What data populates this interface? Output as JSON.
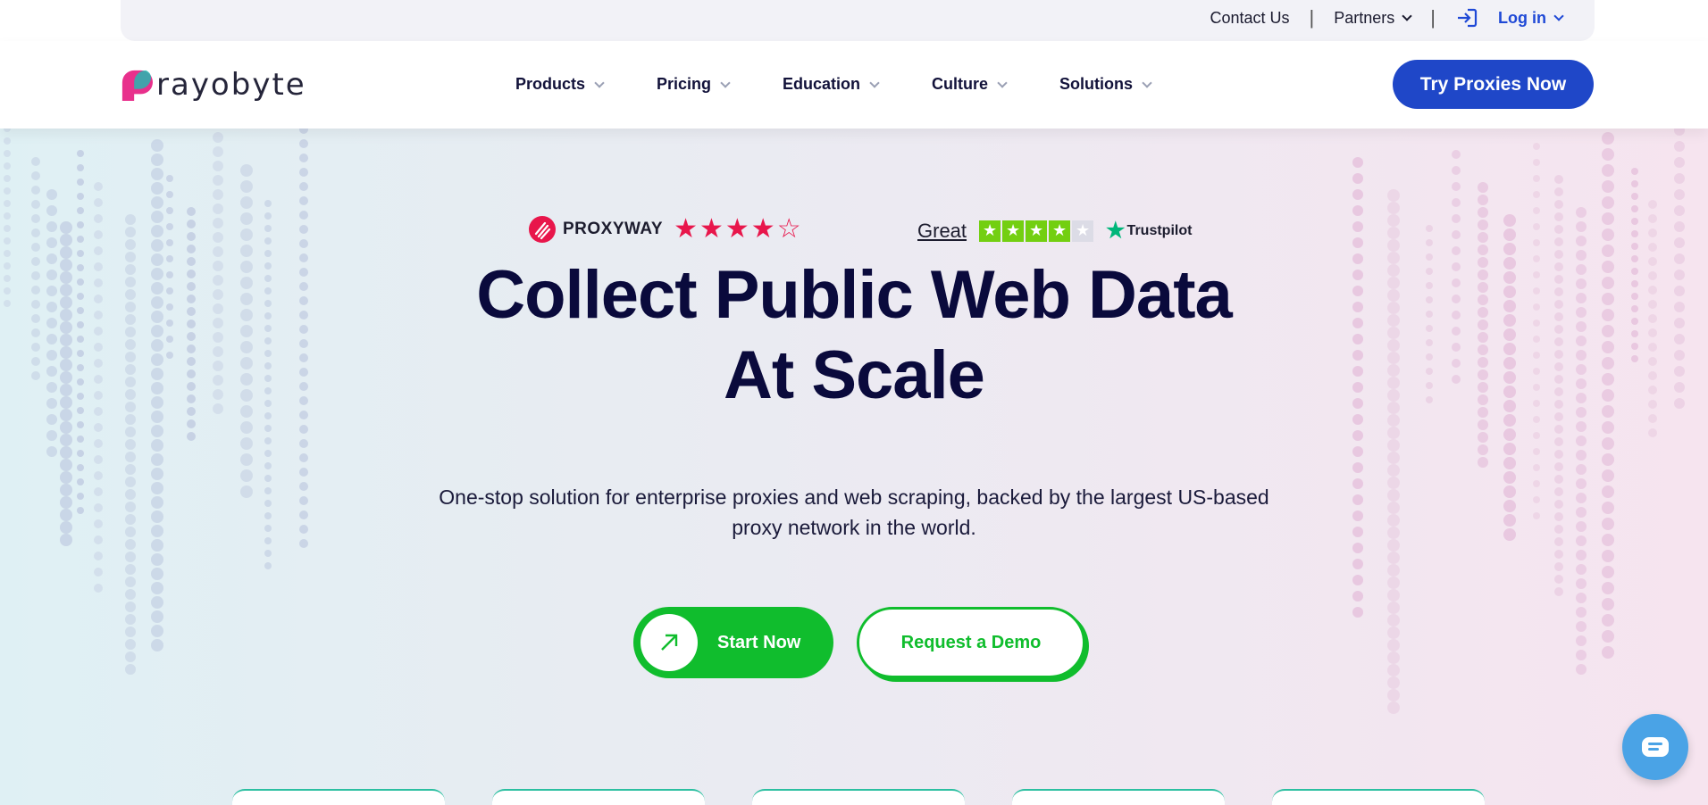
{
  "utility": {
    "contact": "Contact Us",
    "partners": "Partners",
    "login": "Log in"
  },
  "brand": {
    "name": "rayobyte",
    "colors": {
      "primary": "#1f47c8",
      "green": "#10bd2d",
      "pink": "#e8164b"
    }
  },
  "nav": {
    "items": [
      {
        "label": "Products"
      },
      {
        "label": "Pricing"
      },
      {
        "label": "Education"
      },
      {
        "label": "Culture"
      },
      {
        "label": "Solutions"
      }
    ],
    "cta": "Try Proxies Now"
  },
  "ratings": {
    "proxyway_name": "PROXYWAY",
    "proxyway_stars_filled": 4,
    "proxyway_stars_total": 5,
    "trustpilot_label": "Great",
    "trustpilot_stars_filled": 4,
    "trustpilot_stars_total": 5,
    "trustpilot_brand": "Trustpilot"
  },
  "hero": {
    "headline_line1": "Collect Public Web Data",
    "headline_line2": "At Scale",
    "subtext_line1": "One-stop solution for enterprise proxies and web scraping, backed by the largest US-based",
    "subtext_line2": "proxy network in the world.",
    "start_label": "Start Now",
    "demo_label": "Request a Demo"
  },
  "icons": {
    "login": "login-arrow-icon",
    "arrow": "arrow-up-right-icon",
    "chat": "chat-icon"
  }
}
